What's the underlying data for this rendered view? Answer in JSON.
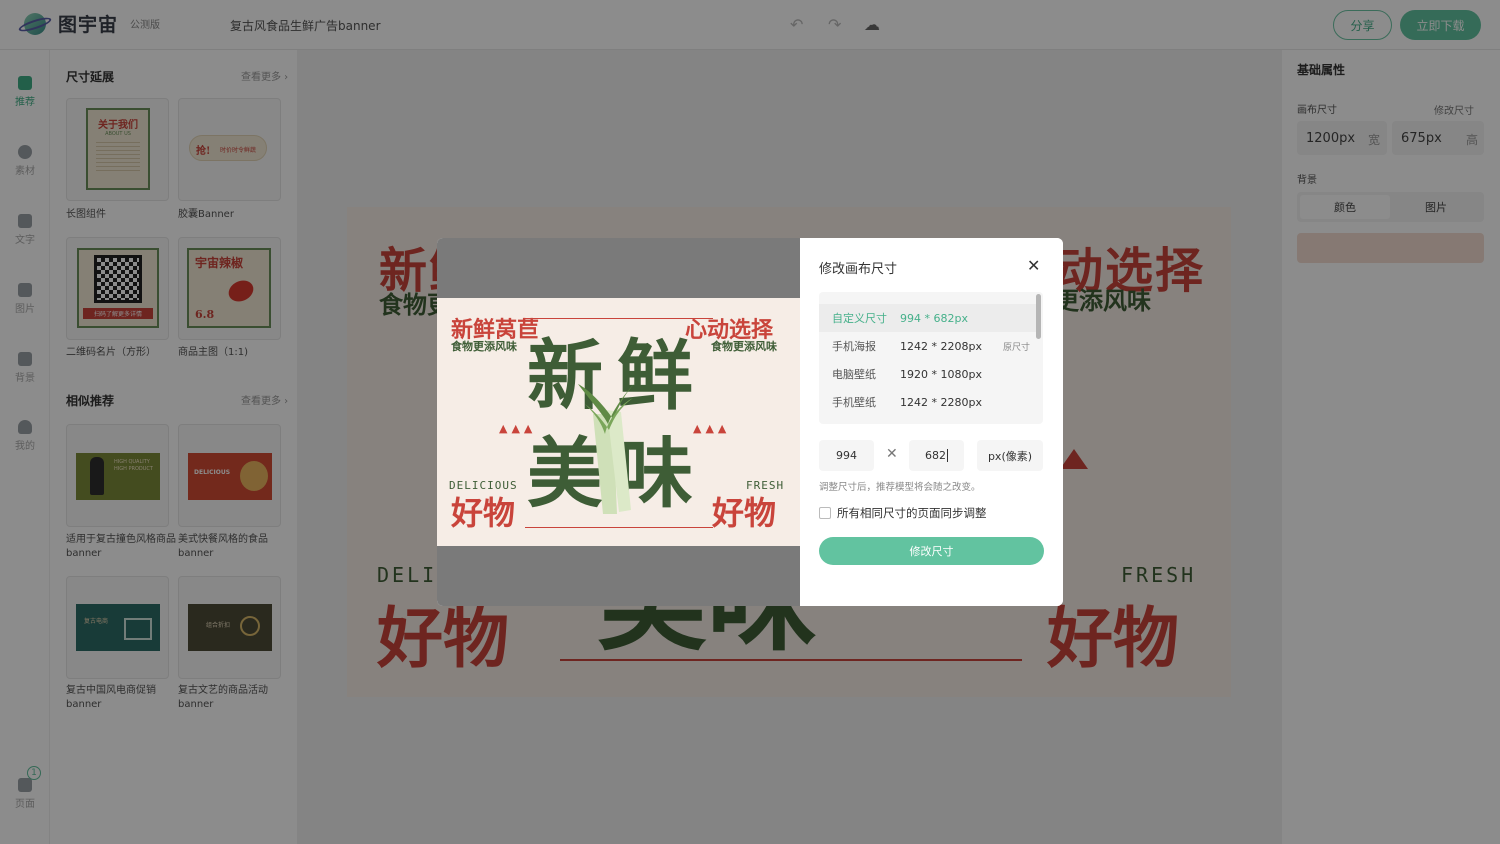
{
  "topbar": {
    "logo_text": "图宇宙",
    "edition": "公测版",
    "doc_title": "复古风食品生鲜广告banner",
    "undo_icon": "undo-icon",
    "redo_icon": "redo-icon",
    "cloud_icon": "cloud-save-icon",
    "share_label": "分享",
    "download_label": "立即下载"
  },
  "nav": {
    "items": [
      {
        "label": "推荐",
        "icon": "recommend-icon"
      },
      {
        "label": "素材",
        "icon": "shapes-icon"
      },
      {
        "label": "文字",
        "icon": "text-icon"
      },
      {
        "label": "图片",
        "icon": "image-icon"
      },
      {
        "label": "背景",
        "icon": "background-icon"
      },
      {
        "label": "我的",
        "icon": "user-icon"
      },
      {
        "label": "页面",
        "icon": "pages-icon"
      }
    ],
    "page_count": "1"
  },
  "panel": {
    "section1": {
      "title": "尺寸延展",
      "more": "查看更多"
    },
    "section2": {
      "title": "相似推荐",
      "more": "查看更多"
    },
    "cards1": [
      {
        "label": "长图组件",
        "thumb_title": "关于我们",
        "thumb_sub": "ABOUT US"
      },
      {
        "label": "胶囊Banner",
        "thumb_title": "抢!",
        "thumb_sub": "时价时令鲜蔬"
      },
      {
        "label": "二维码名片（方形）",
        "thumb_title": "扫码了解更多详情"
      },
      {
        "label": "商品主图（1:1)",
        "thumb_title": "宇宙辣椒",
        "thumb_price": "6.8"
      }
    ],
    "cards2": [
      {
        "label": "适用于复古撞色风格商品banner",
        "thumb_title": "HIGH QUALITY HIGH PRODUCT"
      },
      {
        "label": "美式快餐风格的食品banner",
        "thumb_title": "DELICIOUS"
      },
      {
        "label": "复古中国风电商促销banner",
        "thumb_title": "复古电商"
      },
      {
        "label": "复古文艺的商品活动banner",
        "thumb_title": "组合折扣"
      }
    ]
  },
  "canvas": {
    "top_left_title": "新鲜莴苣",
    "top_left_sub": "食物更添风味",
    "top_right_title": "心动选择",
    "top_right_sub": "食物更添风味",
    "big_top": "新鲜",
    "big_bottom": "美味",
    "left_en": "DELICIOUS",
    "right_en": "FRESH",
    "left_bottom": "好物",
    "right_bottom": "好物"
  },
  "right_panel": {
    "title": "基础属性",
    "canvas_size_label": "画布尺寸",
    "modify_size_link": "修改尺寸",
    "width_value": "1200px",
    "width_unit": "宽",
    "height_value": "675px",
    "height_unit": "高",
    "background_label": "背景",
    "tab_color": "颜色",
    "tab_image": "图片",
    "swatch_color": "#f4ddd2"
  },
  "modal": {
    "title": "修改画布尺寸",
    "presets": [
      {
        "name": "自定义尺寸",
        "size": "994 * 682px",
        "tag": "",
        "selected": true
      },
      {
        "name": "手机海报",
        "size": "1242 * 2208px",
        "tag": "原尺寸",
        "selected": false
      },
      {
        "name": "电脑壁纸",
        "size": "1920 * 1080px",
        "tag": "",
        "selected": false
      },
      {
        "name": "手机壁纸",
        "size": "1242 * 2280px",
        "tag": "",
        "selected": false
      }
    ],
    "width_value": "994",
    "height_value": "682",
    "unit": "px(像素)",
    "hint": "调整尺寸后，推荐模型将会随之改变。",
    "sync_label": "所有相同尺寸的页面同步调整",
    "submit_label": "修改尺寸"
  },
  "colors": {
    "accent": "#62c3a0",
    "accent_text": "#45b08a",
    "art_red": "#c9443b",
    "art_green": "#3e5d36",
    "art_bg": "#f6ede6"
  }
}
